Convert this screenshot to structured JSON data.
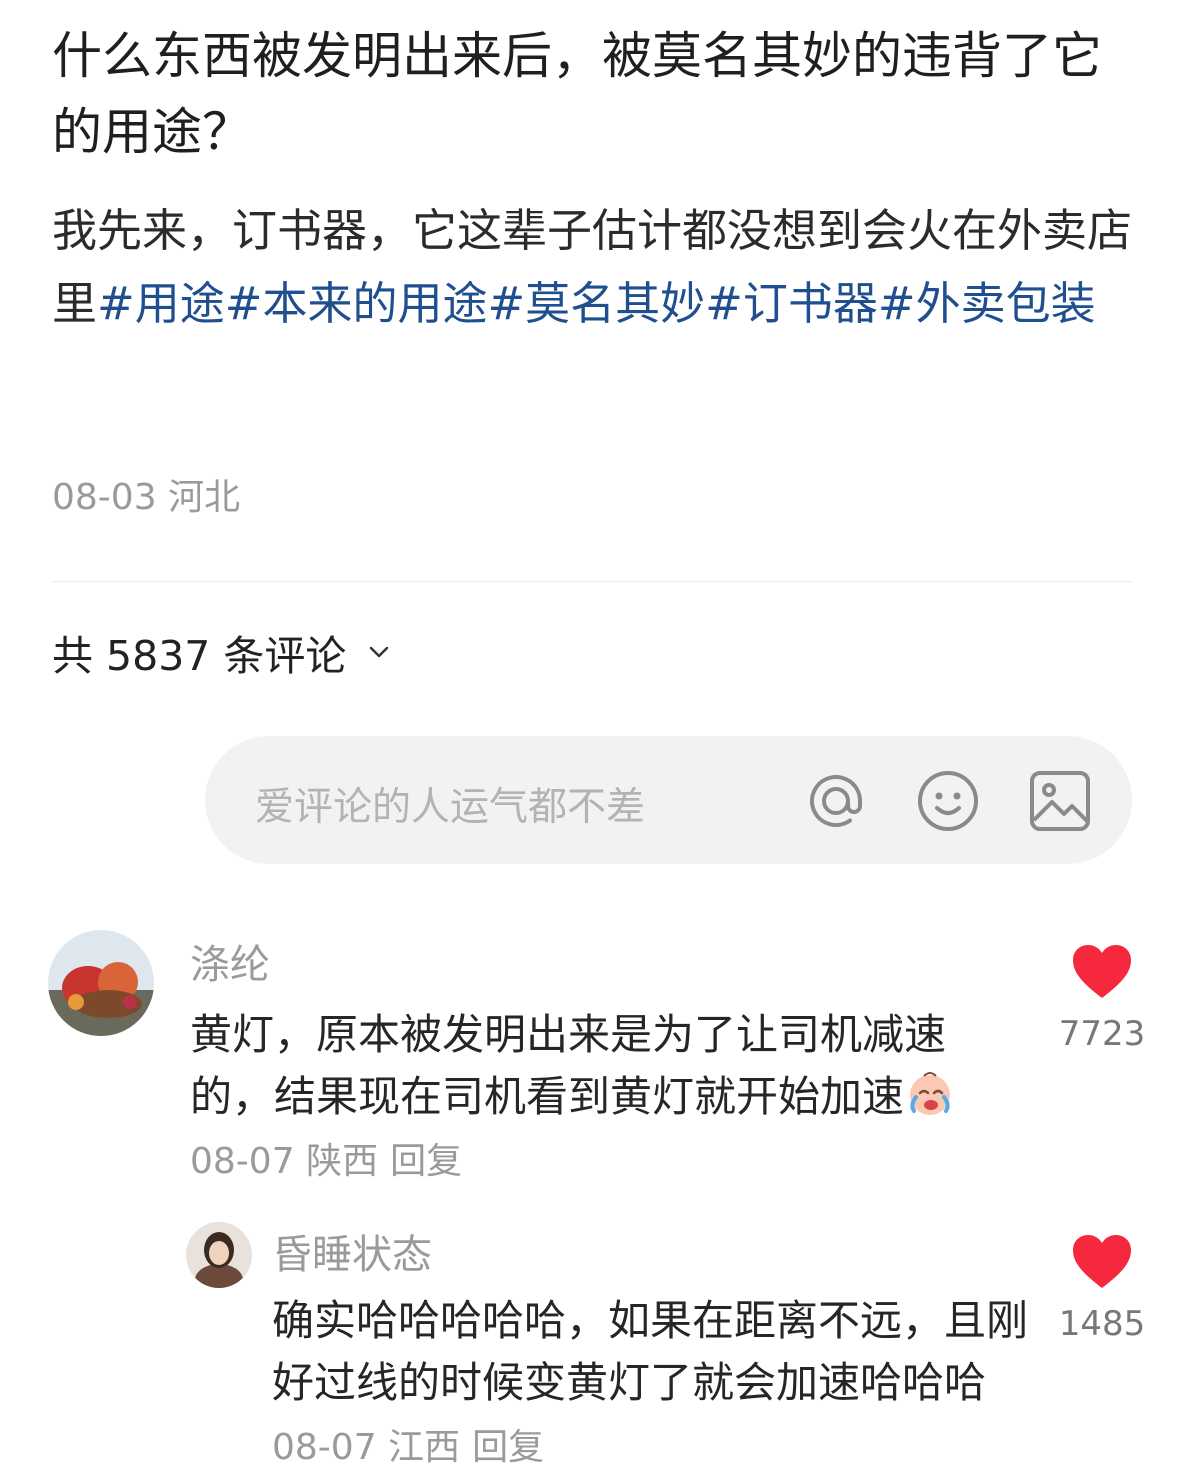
{
  "post": {
    "title": "什么东西被发明出来后，被莫名其妙的违背了它的用途？",
    "body": "我先来，订书器，它这辈子估计都没想到会火在外卖店里",
    "tags": [
      "#用途",
      "#本来的用途",
      "#莫名其妙",
      "#订书器",
      "#外卖包装"
    ],
    "date": "08-03",
    "location": "河北"
  },
  "comments_header": {
    "label": "共 5837 条评论"
  },
  "input": {
    "placeholder": "爱评论的人运气都不差",
    "icons": [
      "at-icon",
      "emoji-icon",
      "image-icon"
    ]
  },
  "comments": [
    {
      "username": "涤纶",
      "text": "黄灯，原本被发明出来是为了让司机减速的，结果现在司机看到黄灯就开始加速",
      "emoji": "crying-laughing-emoji",
      "date": "08-07",
      "location": "陕西",
      "reply_label": "回复",
      "likes": "7723"
    },
    {
      "username": "昏睡状态",
      "text": "确实哈哈哈哈哈，如果在距离不远，且刚好过线的时候变黄灯了就会加速哈哈哈",
      "date": "08-07",
      "location": "江西",
      "reply_label": "回复",
      "likes": "1485"
    }
  ],
  "colors": {
    "tag": "#1f4f8f",
    "heart": "#f5283d",
    "muted": "#9a9a9a",
    "input_bg": "#f2f2f2"
  }
}
